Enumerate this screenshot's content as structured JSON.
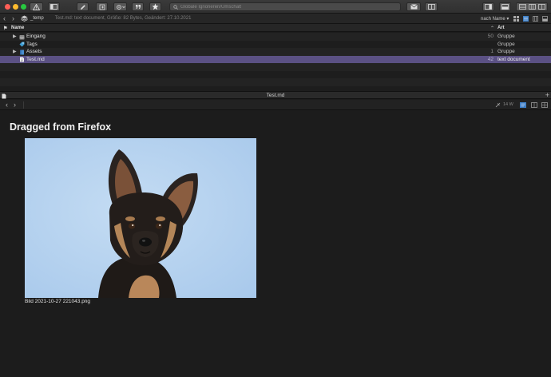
{
  "toolbar": {
    "search_placeholder": "Globale Ignorieren/Umschalt",
    "accent": "#5b5184"
  },
  "pathbar": {
    "folder": "_temp",
    "info": "Test.md: text document, Größe: 82 Bytes, Geändert: 27.10.2021",
    "sort": "nach Name"
  },
  "columns": {
    "name": "Name",
    "kind": "Art"
  },
  "rows": [
    {
      "name": "Eingang",
      "count": "50",
      "kind": "Gruppe",
      "icon": "inbox-icon"
    },
    {
      "name": "Tags",
      "count": "",
      "kind": "Gruppe",
      "icon": "tag-icon"
    },
    {
      "name": "Assets",
      "count": "1",
      "kind": "Gruppe",
      "icon": "folder-icon"
    },
    {
      "name": "Test.md",
      "count": "42",
      "kind": "text document",
      "icon": "document-icon"
    }
  ],
  "document": {
    "title": "Test.md",
    "words": "14 W"
  },
  "preview": {
    "heading": "Dragged from Firefox",
    "caption": "Bild 2021-10-27 221043.png"
  }
}
